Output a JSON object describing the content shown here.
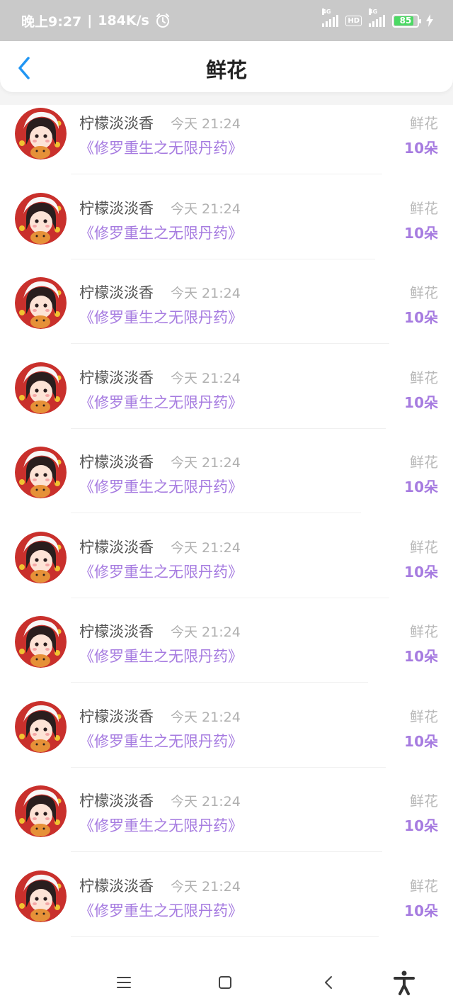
{
  "status_bar": {
    "time": "晚上9:27",
    "speed": "184K/s",
    "sim1": "4G",
    "sim2": "4G",
    "hd": "HD",
    "battery": "85",
    "battery_level": 0.85,
    "icons": [
      "alarm-icon",
      "signal-icon",
      "hd-icon",
      "battery-icon",
      "charging-icon"
    ]
  },
  "header": {
    "title": "鲜花",
    "back_icon": "chevron-left-icon"
  },
  "gifts": [
    {
      "name": "柠檬淡淡香",
      "time": "今天 21:24",
      "book": "《修罗重生之无限丹药》",
      "gift": "鲜花",
      "count": "10朵"
    },
    {
      "name": "柠檬淡淡香",
      "time": "今天 21:24",
      "book": "《修罗重生之无限丹药》",
      "gift": "鲜花",
      "count": "10朵"
    },
    {
      "name": "柠檬淡淡香",
      "time": "今天 21:24",
      "book": "《修罗重生之无限丹药》",
      "gift": "鲜花",
      "count": "10朵"
    },
    {
      "name": "柠檬淡淡香",
      "time": "今天 21:24",
      "book": "《修罗重生之无限丹药》",
      "gift": "鲜花",
      "count": "10朵"
    },
    {
      "name": "柠檬淡淡香",
      "time": "今天 21:24",
      "book": "《修罗重生之无限丹药》",
      "gift": "鲜花",
      "count": "10朵"
    },
    {
      "name": "柠檬淡淡香",
      "time": "今天 21:24",
      "book": "《修罗重生之无限丹药》",
      "gift": "鲜花",
      "count": "10朵"
    },
    {
      "name": "柠檬淡淡香",
      "time": "今天 21:24",
      "book": "《修罗重生之无限丹药》",
      "gift": "鲜花",
      "count": "10朵"
    },
    {
      "name": "柠檬淡淡香",
      "time": "今天 21:24",
      "book": "《修罗重生之无限丹药》",
      "gift": "鲜花",
      "count": "10朵"
    },
    {
      "name": "柠檬淡淡香",
      "time": "今天 21:24",
      "book": "《修罗重生之无限丹药》",
      "gift": "鲜花",
      "count": "10朵"
    },
    {
      "name": "柠檬淡淡香",
      "time": "今天 21:24",
      "book": "《修罗重生之无限丹药》",
      "gift": "鲜花",
      "count": "10朵"
    }
  ],
  "nav": {
    "icons": [
      "menu-icon",
      "home-square-icon",
      "back-icon",
      "accessibility-icon"
    ]
  },
  "colors": {
    "accent": "#a67be0",
    "back_arrow": "#2196f3",
    "status_bar_bg": "#c9c9c9",
    "battery_green": "#4cd964"
  }
}
